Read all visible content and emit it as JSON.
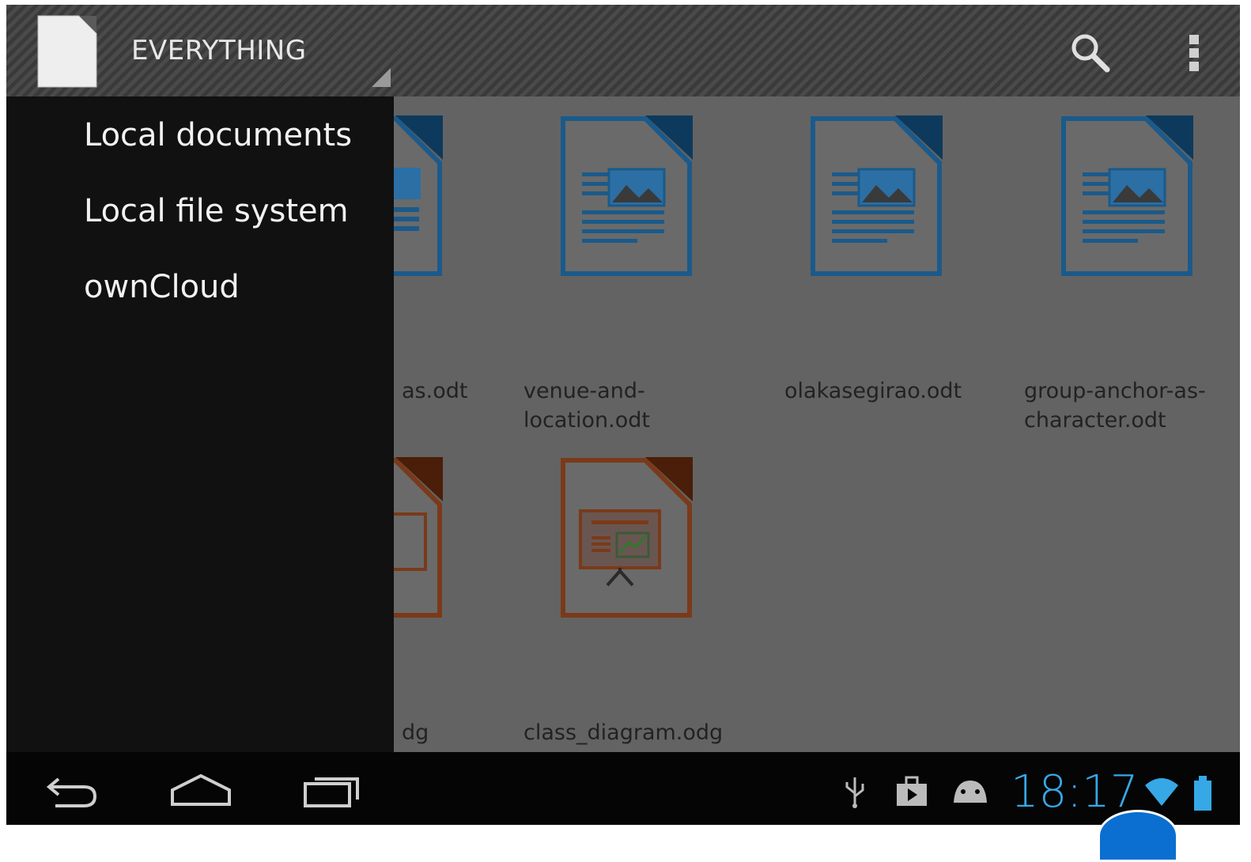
{
  "actionbar": {
    "title": "EVERYTHING",
    "icons": [
      "libreoffice-document-icon",
      "search-icon",
      "overflow-menu-icon"
    ]
  },
  "drawer": {
    "items": [
      {
        "label": "Local documents"
      },
      {
        "label": "Local file system"
      },
      {
        "label": "ownCloud"
      }
    ]
  },
  "documents": [
    {
      "name": "as.odt",
      "type": "writer",
      "color": "#1b5a8a"
    },
    {
      "name": "venue-and-location.odt",
      "type": "writer",
      "color": "#1b5a8a"
    },
    {
      "name": "olakasegirao.odt",
      "type": "writer",
      "color": "#1b5a8a"
    },
    {
      "name": "group-anchor-as-character.odt",
      "type": "writer",
      "color": "#1b5a8a"
    },
    {
      "name": "dg",
      "type": "impress",
      "color": "#7a3a1a"
    },
    {
      "name": "class_diagram.odg",
      "type": "impress",
      "color": "#7a3a1a"
    }
  ],
  "statusbar": {
    "time": "18:17",
    "clock_color": "#36a8e6",
    "icons": [
      "usb-icon",
      "store-icon",
      "android-debug-icon",
      "wifi-icon",
      "battery-icon"
    ]
  },
  "navbar": {
    "icons": [
      "back-icon",
      "home-icon",
      "recents-icon"
    ]
  }
}
